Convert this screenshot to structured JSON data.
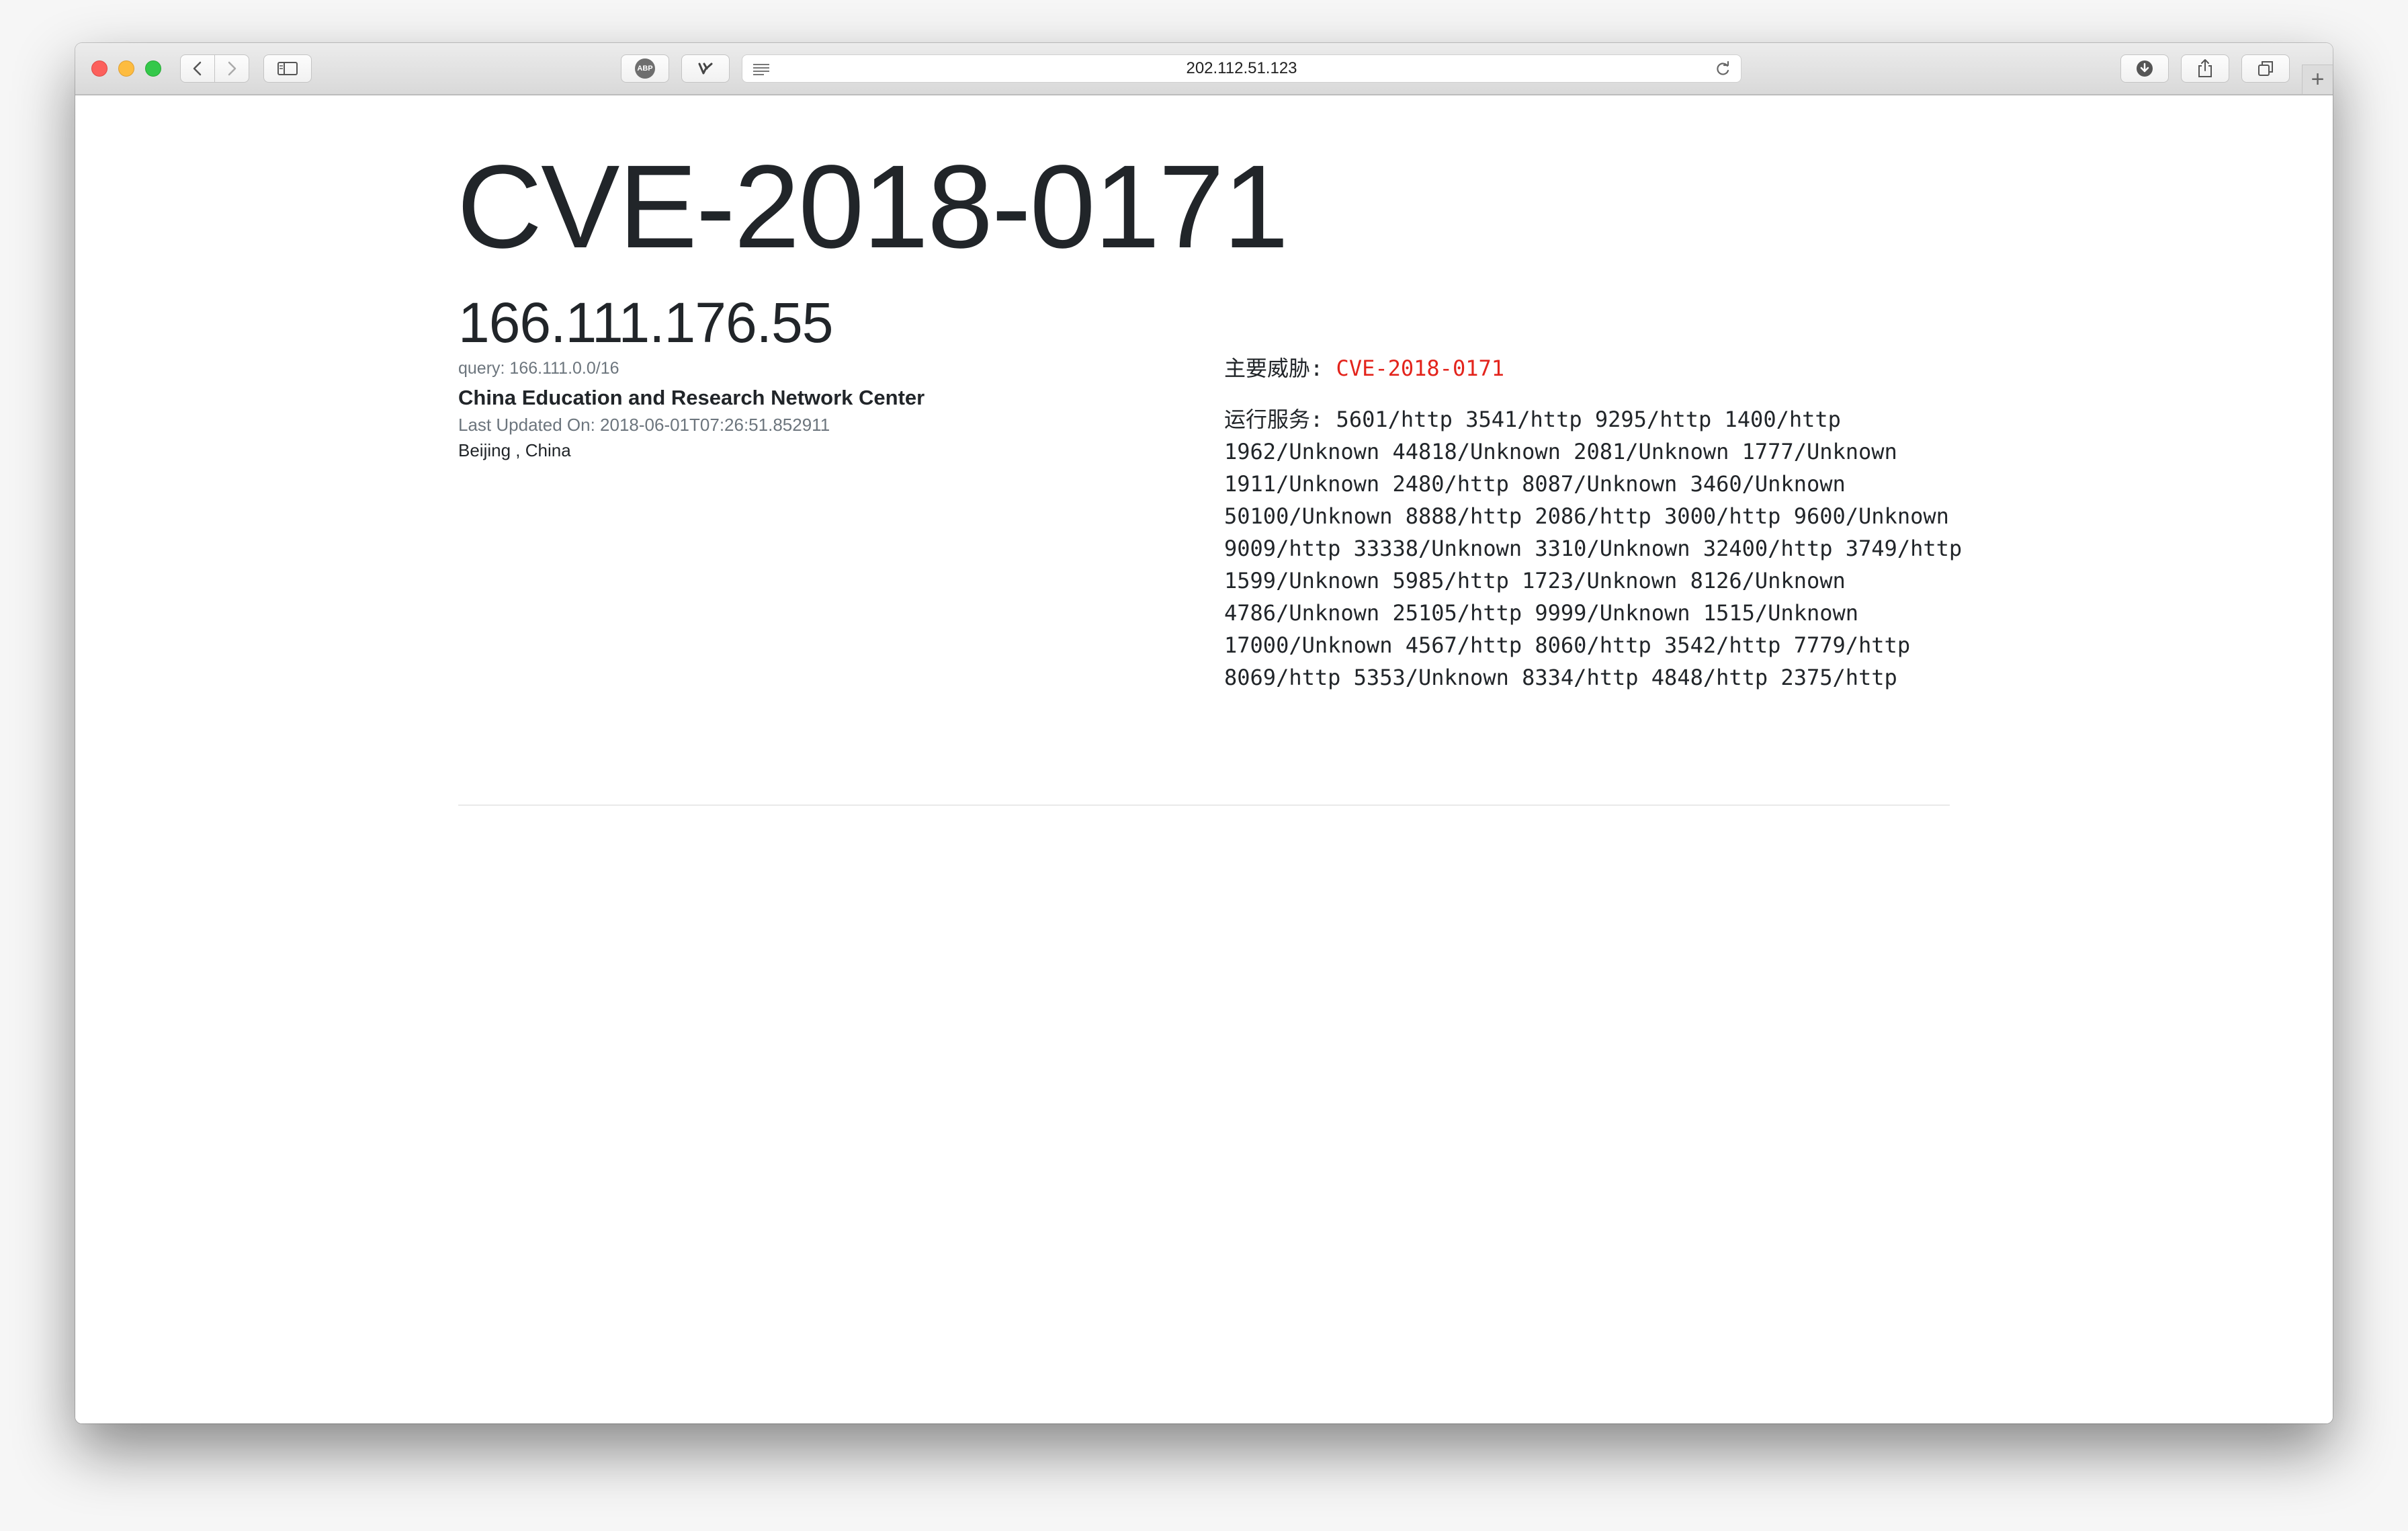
{
  "browser": {
    "url": "202.112.51.123",
    "adblock_label": "ABP",
    "new_tab_label": "+"
  },
  "page": {
    "title": "CVE-2018-0171",
    "ip": "166.111.176.55",
    "query": "query: 166.111.0.0/16",
    "org": "China Education and Research Network Center",
    "last_updated": "Last Updated On: 2018-06-01T07:26:51.852911",
    "location": "Beijing , China",
    "threat_label": "主要威胁:",
    "threat_value": "CVE-2018-0171",
    "threat_color": "#e3241c",
    "services_label": "运行服务:",
    "services": [
      "5601/http",
      "3541/http",
      "9295/http",
      "1400/http",
      "1962/Unknown",
      "44818/Unknown",
      "2081/Unknown",
      "1777/Unknown",
      "1911/Unknown",
      "2480/http",
      "8087/Unknown",
      "3460/Unknown",
      "50100/Unknown",
      "8888/http",
      "2086/http",
      "3000/http",
      "9600/Unknown",
      "9009/http",
      "33338/Unknown",
      "3310/Unknown",
      "32400/http",
      "3749/http",
      "1599/Unknown",
      "5985/http",
      "1723/Unknown",
      "8126/Unknown",
      "4786/Unknown",
      "25105/http",
      "9999/Unknown",
      "1515/Unknown",
      "17000/Unknown",
      "4567/http",
      "8060/http",
      "3542/http",
      "7779/http",
      "8069/http",
      "5353/Unknown",
      "8334/http",
      "4848/http",
      "2375/http"
    ]
  }
}
